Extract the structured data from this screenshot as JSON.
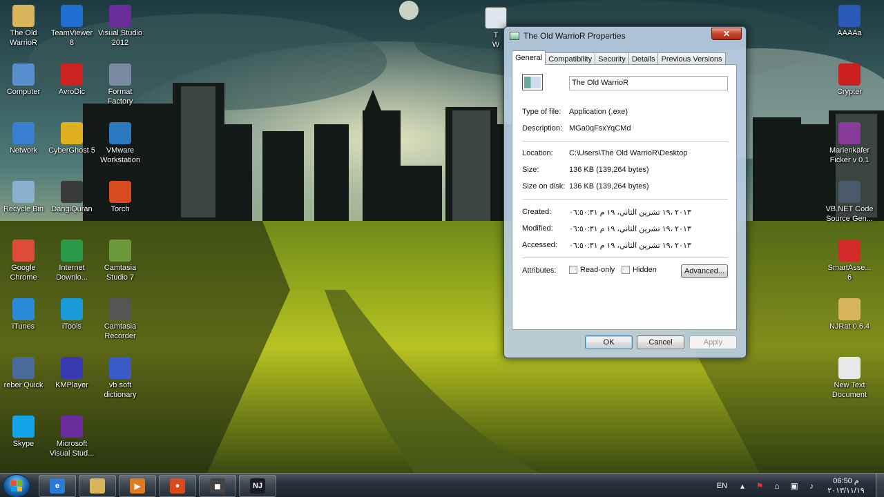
{
  "desktop": {
    "left_icons": [
      {
        "label": "The Old\nWarrioR",
        "icon": "folder-icon",
        "color": "#d8b45a"
      },
      {
        "label": "TeamViewer\n8",
        "icon": "teamviewer-icon",
        "color": "#1f6fd0"
      },
      {
        "label": "Visual Studio\n2012",
        "icon": "visual-studio-icon",
        "color": "#6a2c9a"
      },
      {
        "label": "Computer",
        "icon": "computer-icon",
        "color": "#5a8fcf"
      },
      {
        "label": "AvroDic",
        "icon": "avrodic-icon",
        "color": "#cc2222"
      },
      {
        "label": "Format\nFactory",
        "icon": "format-factory-icon",
        "color": "#7a8aa0"
      },
      {
        "label": "Network",
        "icon": "network-icon",
        "color": "#3a7fcf"
      },
      {
        "label": "CyberGhost 5",
        "icon": "cyberghost-icon",
        "color": "#e0b020"
      },
      {
        "label": "VMware\nWorkstation",
        "icon": "vmware-icon",
        "color": "#2a78c0"
      },
      {
        "label": "Recycle Bin",
        "icon": "recycle-bin-icon",
        "color": "#8ab0d0"
      },
      {
        "label": "DangiQuran",
        "icon": "dangiquran-icon",
        "color": "#3a3a3a"
      },
      {
        "label": "Torch",
        "icon": "torch-icon",
        "color": "#d84a20"
      },
      {
        "label": "Google\nChrome",
        "icon": "chrome-icon",
        "color": "#dd4b39"
      },
      {
        "label": "Internet\nDownlo...",
        "icon": "internet-download-manager-icon",
        "color": "#2a9a4a"
      },
      {
        "label": "Camtasia\nStudio 7",
        "icon": "camtasia-studio-icon",
        "color": "#6a9a3a"
      },
      {
        "label": "iTunes",
        "icon": "itunes-icon",
        "color": "#2a8ad8"
      },
      {
        "label": "iTools",
        "icon": "itools-icon",
        "color": "#1a9ad8"
      },
      {
        "label": "Camtasia\nRecorder",
        "icon": "camtasia-recorder-icon",
        "color": "#555555"
      },
      {
        "label": "reber Quick",
        "icon": "reber-quick-icon",
        "color": "#4a6a9a"
      },
      {
        "label": "KMPlayer",
        "icon": "kmplayer-icon",
        "color": "#3a3ab0"
      },
      {
        "label": "vb soft\ndictionary",
        "icon": "vb-soft-dictionary-icon",
        "color": "#3a5ac8"
      },
      {
        "label": "Skype",
        "icon": "skype-icon",
        "color": "#12a5e8"
      },
      {
        "label": "Microsoft\nVisual Stud...",
        "icon": "microsoft-visual-studio-icon",
        "color": "#6a2c9a"
      }
    ],
    "partial_icon_label": "T\nW",
    "right_icons": [
      {
        "label": "AAAAa",
        "icon": "word-document-icon",
        "color": "#2a5ab8"
      },
      {
        "label": "Crypter",
        "icon": "crypter-ladybug-icon",
        "color": "#cc2020"
      },
      {
        "label": "Marienkäfer\nFicker v 0.1",
        "icon": "winrar-archive-icon",
        "color": "#8a3a9a"
      },
      {
        "label": "VB.NET Code\nSource Gen...",
        "icon": "vbnet-code-icon",
        "color": "#4a5a6a"
      },
      {
        "label": "SmartAsse...\n6",
        "icon": "smartassembly-icon",
        "color": "#d42a2a"
      },
      {
        "label": "NJRat 0.6.4",
        "icon": "folder-icon",
        "color": "#d8b45a"
      },
      {
        "label": "New Text\nDocument",
        "icon": "text-document-icon",
        "color": "#e8e8e8"
      }
    ]
  },
  "window": {
    "title": "The Old WarrioR Properties",
    "close_label": "✕",
    "tabs": [
      "General",
      "Compatibility",
      "Security",
      "Details",
      "Previous Versions"
    ],
    "active_tab": "General",
    "file_name": "The Old WarrioR",
    "type_of_file": {
      "label": "Type of file:",
      "value": "Application (.exe)"
    },
    "description": {
      "label": "Description:",
      "value": "MGa0qFsxYqCMd"
    },
    "location": {
      "label": "Location:",
      "value": "C:\\Users\\The Old WarrioR\\Desktop"
    },
    "size": {
      "label": "Size:",
      "value": "136 KB (139,264 bytes)"
    },
    "size_on_disk": {
      "label": "Size on disk:",
      "value": "136 KB (139,264 bytes)"
    },
    "created": {
      "label": "Created:",
      "value": "٢٠١٣ ،١٩ تشرين الثاني، ١٩ م ٠٦:٥٠:٣١"
    },
    "modified": {
      "label": "Modified:",
      "value": "٢٠١٣ ،١٩ تشرين الثاني، ١٩ م ٠٦:٥٠:٣١"
    },
    "accessed": {
      "label": "Accessed:",
      "value": "٢٠١٣ ،١٩ تشرين الثاني، ١٩ م ٠٦:٥٠:٣١"
    },
    "attributes_label": "Attributes:",
    "read_only_label": "Read-only",
    "hidden_label": "Hidden",
    "advanced_label": "Advanced...",
    "ok_label": "OK",
    "cancel_label": "Cancel",
    "apply_label": "Apply"
  },
  "taskbar": {
    "pinned": [
      {
        "icon": "internet-explorer-icon",
        "color": "#2a7ad8",
        "glyph": "e"
      },
      {
        "icon": "windows-explorer-icon",
        "color": "#d8b45a",
        "glyph": ""
      },
      {
        "icon": "media-player-icon",
        "color": "#e07a20",
        "glyph": "▶"
      },
      {
        "icon": "browser-icon",
        "color": "#d84a20",
        "glyph": "●"
      },
      {
        "icon": "recorder-icon",
        "color": "#444444",
        "glyph": "◼"
      },
      {
        "icon": "njrat-icon",
        "color": "#1a1a2a",
        "glyph": "NJ"
      }
    ],
    "language": "EN",
    "clock_time": "06:50 م",
    "clock_date": "٢٠١٣/١١/١٩"
  }
}
